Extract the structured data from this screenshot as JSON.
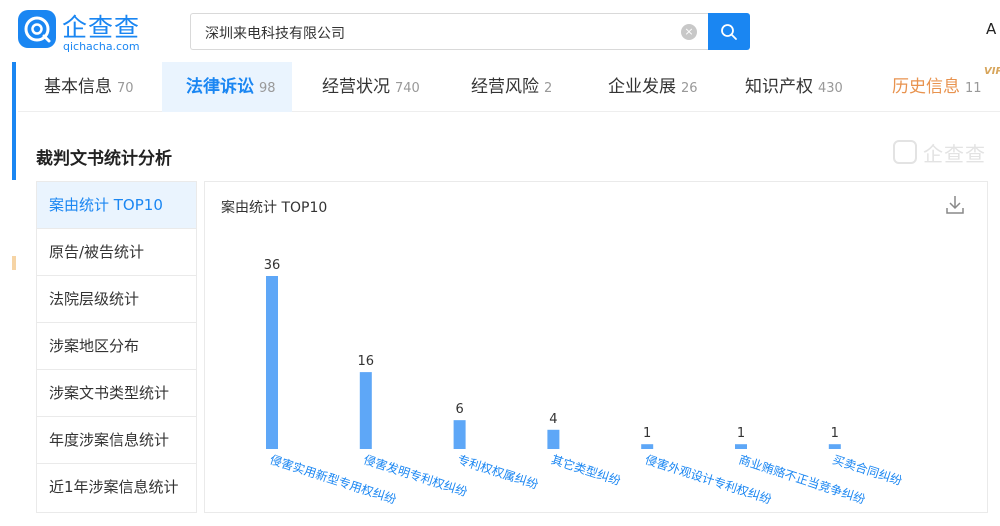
{
  "header": {
    "logo_text": "企查查",
    "logo_domain": "qichacha.com",
    "search_value": "深圳来电科技有限公司",
    "clear_symbol": "×",
    "right_letter": "A"
  },
  "tabs": [
    {
      "label": "基本信息",
      "count": "70"
    },
    {
      "label": "法律诉讼",
      "count": "98"
    },
    {
      "label": "经营状况",
      "count": "740"
    },
    {
      "label": "经营风险",
      "count": "2"
    },
    {
      "label": "企业发展",
      "count": "26"
    },
    {
      "label": "知识产权",
      "count": "430"
    },
    {
      "label": "历史信息",
      "count": "11"
    }
  ],
  "vip_tag": "VIP",
  "section_title": "裁判文书统计分析",
  "watermark_text": "企查查",
  "sidebar": [
    "案由统计 TOP10",
    "原告/被告统计",
    "法院层级统计",
    "涉案地区分布",
    "涉案文书类型统计",
    "年度涉案信息统计",
    "近1年涉案信息统计"
  ],
  "panel_title": "案由统计 TOP10",
  "colors": {
    "accent": "#1a86f2",
    "bar": "#5ea7f7",
    "label": "#1a86f2"
  },
  "icons": [
    "logo-icon",
    "search-icon",
    "clear-icon",
    "download-icon"
  ],
  "chart_data": {
    "type": "bar",
    "title": "案由统计 TOP10",
    "categories": [
      "侵害实用新型专用权纠纷",
      "侵害发明专利权纠纷",
      "专利权权属纠纷",
      "其它类型纠纷",
      "侵害外观设计专利权纠纷",
      "商业贿赂不正当竞争纠纷",
      "买卖合同纠纷"
    ],
    "values": [
      36,
      16,
      6,
      4,
      1,
      1,
      1
    ],
    "ylim": [
      0,
      36
    ],
    "grid": false,
    "legend": "none"
  }
}
